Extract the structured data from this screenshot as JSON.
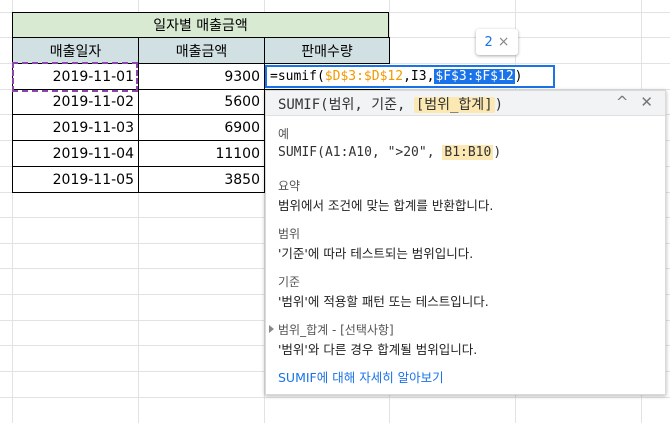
{
  "table": {
    "title": "일자별 매출금액",
    "headers": [
      "매출일자",
      "매출금액",
      "판매수량"
    ],
    "rows": [
      {
        "date": "2019-11-01",
        "amount": "9300"
      },
      {
        "date": "2019-11-02",
        "amount": "5600"
      },
      {
        "date": "2019-11-03",
        "amount": "6900"
      },
      {
        "date": "2019-11-04",
        "amount": "11100"
      },
      {
        "date": "2019-11-05",
        "amount": "3850"
      }
    ]
  },
  "formula": {
    "prefix": "=sumif(",
    "range1": "$D$3:$D$12",
    "sep1": ",",
    "crit": "I3",
    "sep2": ",",
    "range2": "$F$3:$F$12",
    "suffix": ")"
  },
  "chip": {
    "count": "2",
    "close": "×"
  },
  "popup": {
    "signature_prefix": "SUMIF(범위, 기준, ",
    "signature_arg": "[범위_합계]",
    "signature_suffix": ")",
    "collapse_icon": "^",
    "close_icon": "✕",
    "example_label": "예",
    "example_prefix": "SUMIF(A1:A10, \">20\", ",
    "example_hl": "B1:B10",
    "example_suffix": ")",
    "summary_label": "요약",
    "summary_body": "범위에서 조건에 맞는 합계를 반환합니다.",
    "range_label": "범위",
    "range_body": "'기준'에 따라 테스트되는 범위입니다.",
    "criterion_label": "기준",
    "criterion_body": "'범위'에 적용할 패턴 또는 테스트입니다.",
    "sumrange_label": "범위_합계 - [선택사항]",
    "sumrange_body": "'범위'와 다른 경우 합계될 범위입니다.",
    "learn_more": "SUMIF에 대해 자세히 알아보기"
  }
}
